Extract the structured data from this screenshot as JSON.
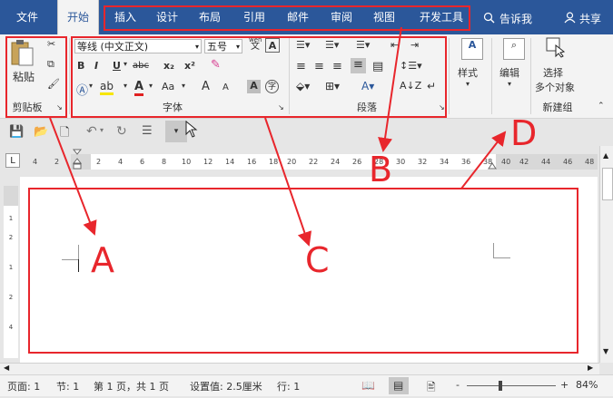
{
  "tabs": [
    "文件",
    "开始",
    "插入",
    "设计",
    "布局",
    "引用",
    "邮件",
    "审阅",
    "视图",
    "开发工具"
  ],
  "active_tab": "开始",
  "tell_me": "告诉我",
  "share": "共享",
  "clipboard": {
    "paste": "粘贴",
    "group_label": "剪贴板"
  },
  "font": {
    "family": "等线 (中文正文)",
    "size": "五号",
    "group_label": "字体",
    "wen": "wén",
    "wen_char": "文",
    "bold": "B",
    "italic": "I",
    "underline": "U",
    "strike": "abc",
    "sub": "x₂",
    "sup": "x²",
    "aa": "Aa",
    "grow": "A",
    "shrink": "A",
    "shade_a": "A",
    "circle": "字"
  },
  "paragraph": {
    "group_label": "段落"
  },
  "styles": {
    "label": "样式"
  },
  "editing": {
    "label": "编辑"
  },
  "select_objects": {
    "line1": "选择",
    "line2": "多个对象",
    "group_label": "新建组"
  },
  "ruler_ticks": [
    "4",
    "2",
    "2",
    "4",
    "6",
    "8",
    "10",
    "12",
    "14",
    "16",
    "18",
    "20",
    "22",
    "24",
    "26",
    "28",
    "30",
    "32",
    "34",
    "36",
    "38",
    "40",
    "42",
    "44",
    "46",
    "48"
  ],
  "vruler_marks": [
    "1",
    "2",
    "1",
    "2",
    "4"
  ],
  "status": {
    "page": "页面: 1",
    "section": "节: 1",
    "pages": "第 1 页，共 1 页",
    "setting": "设置值: 2.5厘米",
    "line": "行: 1",
    "zoom": "84%",
    "minus": "-",
    "plus": "+"
  },
  "annotations": {
    "A": "A",
    "B": "B",
    "C": "C",
    "D": "D"
  },
  "colors": {
    "brand": "#2b579a",
    "annotation": "#e8262c"
  }
}
